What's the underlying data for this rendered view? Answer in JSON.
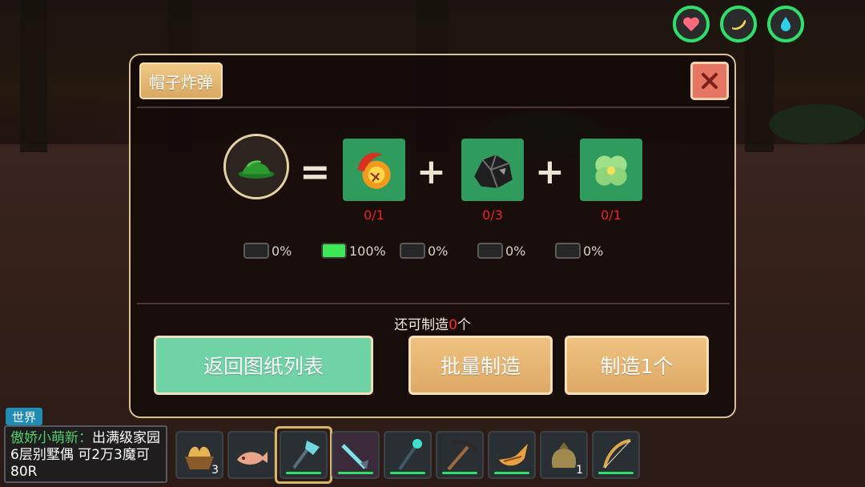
{
  "status_icons": [
    "heart-icon",
    "stamina-icon",
    "water-icon"
  ],
  "colors": {
    "status_ring": "#2ee06a",
    "count_red": "#e6262a",
    "panel_border": "#d6c293"
  },
  "panel": {
    "title": "帽子炸弹",
    "close_icon": "close-icon"
  },
  "recipe": {
    "result_icon": "green-helmet-icon",
    "ingredients": [
      {
        "icon": "fire-fruit-icon",
        "count": "0/1"
      },
      {
        "icon": "coal-ore-icon",
        "count": "0/3"
      },
      {
        "icon": "clover-icon",
        "count": "0/1"
      }
    ]
  },
  "probabilities": [
    {
      "value": "0%",
      "active": false
    },
    {
      "value": "100%",
      "active": true
    },
    {
      "value": "0%",
      "active": false
    },
    {
      "value": "0%",
      "active": false
    },
    {
      "value": "0%",
      "active": false
    }
  ],
  "remaining": {
    "prefix": "还可制造",
    "count": "0",
    "suffix": "个"
  },
  "buttons": {
    "back": "返回图纸列表",
    "batch": "批量制造",
    "craft_one": "制造1个"
  },
  "chat": {
    "channel": "世界",
    "sender": "傲娇小萌新：",
    "message": "出满级家园  6层别墅偶  可2万3魔可80R"
  },
  "hotbar": [
    {
      "icon": "bread-basket-icon",
      "count": "3",
      "durability": null
    },
    {
      "icon": "fish-icon",
      "count": "",
      "durability": null
    },
    {
      "icon": "crystal-axe-icon",
      "count": "",
      "durability": 1.0,
      "selected": true
    },
    {
      "icon": "crystal-sword-icon",
      "count": "",
      "durability": 1.0
    },
    {
      "icon": "magic-staff-icon",
      "count": "",
      "durability": 1.0
    },
    {
      "icon": "pickaxe-icon",
      "count": "",
      "durability": 1.0
    },
    {
      "icon": "gourd-horn-icon",
      "count": "",
      "durability": 1.0
    },
    {
      "icon": "seed-sack-icon",
      "count": "1",
      "durability": null
    },
    {
      "icon": "bow-icon",
      "count": "",
      "durability": 1.0
    }
  ]
}
